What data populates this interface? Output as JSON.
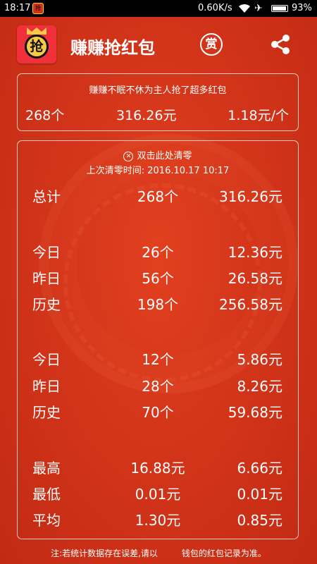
{
  "status_bar": {
    "time": "18:17",
    "notification_icon": "抢",
    "net_speed": "0.60K/s",
    "battery_level": 0.93,
    "battery": "93%"
  },
  "app_bar": {
    "app_icon_glyph": "抢",
    "title": "赚赚抢红包",
    "reward_label": "赏"
  },
  "summary": {
    "caption": "赚赚不眠不休为主人抢了超多红包",
    "count": "268个",
    "amount": "316.26元",
    "average": "1.18元/个"
  },
  "stats": {
    "clear_label": "双击此处清零",
    "last_clear_label": "上次清零时间:",
    "last_clear_time": "2016.10.17 10:17",
    "total": {
      "label": "总计",
      "count": "268个",
      "amount": "316.26元"
    },
    "group1": [
      {
        "label": "今日",
        "count": "26个",
        "amount": "12.36元"
      },
      {
        "label": "昨日",
        "count": "56个",
        "amount": "26.58元"
      },
      {
        "label": "历史",
        "count": "198个",
        "amount": "256.58元"
      }
    ],
    "group2": [
      {
        "label": "今日",
        "count": "12个",
        "amount": "5.86元"
      },
      {
        "label": "昨日",
        "count": "28个",
        "amount": "8.26元"
      },
      {
        "label": "历史",
        "count": "70个",
        "amount": "59.68元"
      }
    ],
    "extremes": [
      {
        "label": "最高",
        "v1": "16.88元",
        "v2": "6.66元"
      },
      {
        "label": "最低",
        "v1": "0.01元",
        "v2": "0.01元"
      },
      {
        "label": "平均",
        "v1": "1.30元",
        "v2": "0.85元"
      }
    ]
  },
  "footnote": {
    "before": "注:若统计数据存在误差,请以",
    "after": "钱包的红包记录为准。"
  },
  "colors": {
    "background": "#d3351a",
    "accent_gold": "#f7c948",
    "text": "#ffffff"
  },
  "icons": {
    "wifi": "wifi-icon",
    "airplane": "airplane-mode-icon",
    "clear": "close-circle-icon",
    "share": "share-icon",
    "reward": "reward-icon"
  }
}
